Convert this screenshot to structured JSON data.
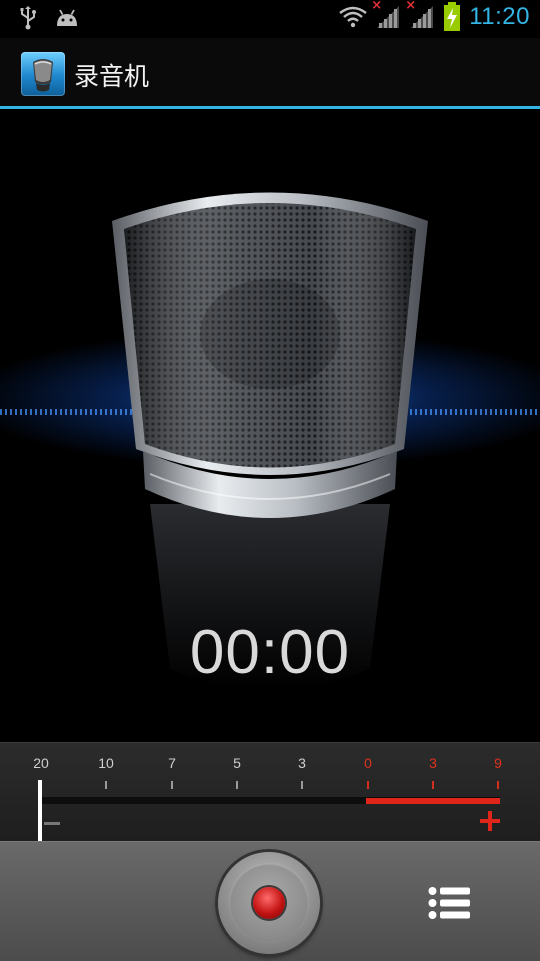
{
  "status_bar": {
    "time": "11:20",
    "icons": [
      "usb-icon",
      "android-debug-icon",
      "wifi-icon",
      "signal-no-service-icon",
      "signal-no-service-icon",
      "battery-charging-icon"
    ],
    "no_signal_mark": "×"
  },
  "action_bar": {
    "title": "录音机",
    "icon": "voice-recorder-app-icon"
  },
  "recorder": {
    "time": "00:00"
  },
  "meter": {
    "labels": [
      "20",
      "10",
      "7",
      "5",
      "3",
      "0",
      "3",
      "9"
    ],
    "minus_icon": "minus-icon",
    "plus_icon": "plus-icon"
  },
  "bottom_bar": {
    "record_icon": "record-icon",
    "list_icon": "recordings-list-icon"
  },
  "colors": {
    "accent": "#33b5e5",
    "level_red": "#e0261a",
    "glow_blue": "#2c8cff"
  }
}
